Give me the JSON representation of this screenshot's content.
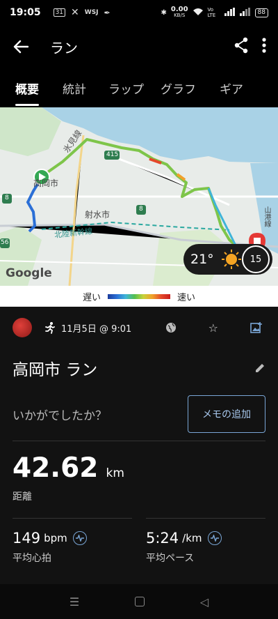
{
  "status_bar": {
    "time": "19:05",
    "left_icons": [
      "calendar-icon",
      "x-icon",
      "wsj-icon",
      "feather-icon"
    ],
    "calendar_label": "31",
    "wsj_label": "WSJ",
    "network_speed": "0.00",
    "network_unit": "KB/S",
    "volte": "Vo LTE",
    "battery": "88"
  },
  "app_bar": {
    "title": "ラン",
    "back_icon": "back-arrow-icon",
    "share_icon": "share-icon",
    "more_icon": "more-vert-icon"
  },
  "tabs": [
    {
      "label": "概要",
      "active": true
    },
    {
      "label": "統計",
      "active": false
    },
    {
      "label": "ラップ",
      "active": false
    },
    {
      "label": "グラフ",
      "active": false
    },
    {
      "label": "ギア",
      "active": false
    }
  ],
  "map": {
    "place_labels": {
      "city": "高岡市",
      "imizu": "射水市",
      "himi_line": "氷見線",
      "shinkansen": "北陸新幹線",
      "route_415": "415",
      "route_8a": "8",
      "route_8b": "8",
      "route_8c": "8",
      "route_56": "56",
      "right_side": "山港線"
    },
    "google_logo": "Google",
    "weather": {
      "temperature": "21°",
      "icon": "sun-icon",
      "wind": "15"
    }
  },
  "legend": {
    "slow": "遅い",
    "fast": "速い"
  },
  "activity": {
    "date": "11月5日 @ 9:01",
    "title": "高岡市 ラン",
    "feeling_prompt": "いかがでしたか？",
    "memo_button": "メモの追加",
    "distance": {
      "value": "42.62",
      "unit": "km",
      "label": "距離"
    },
    "heart_rate": {
      "value": "149",
      "unit": "bpm",
      "label": "平均心拍"
    },
    "pace": {
      "value": "5:24",
      "unit": "/km",
      "label": "平均ペース"
    }
  },
  "colors": {
    "background": "#121212",
    "accent": "#7aa6d6",
    "route_green": "#7ec54a",
    "start_marker": "#34a853",
    "end_marker": "#e53935"
  }
}
